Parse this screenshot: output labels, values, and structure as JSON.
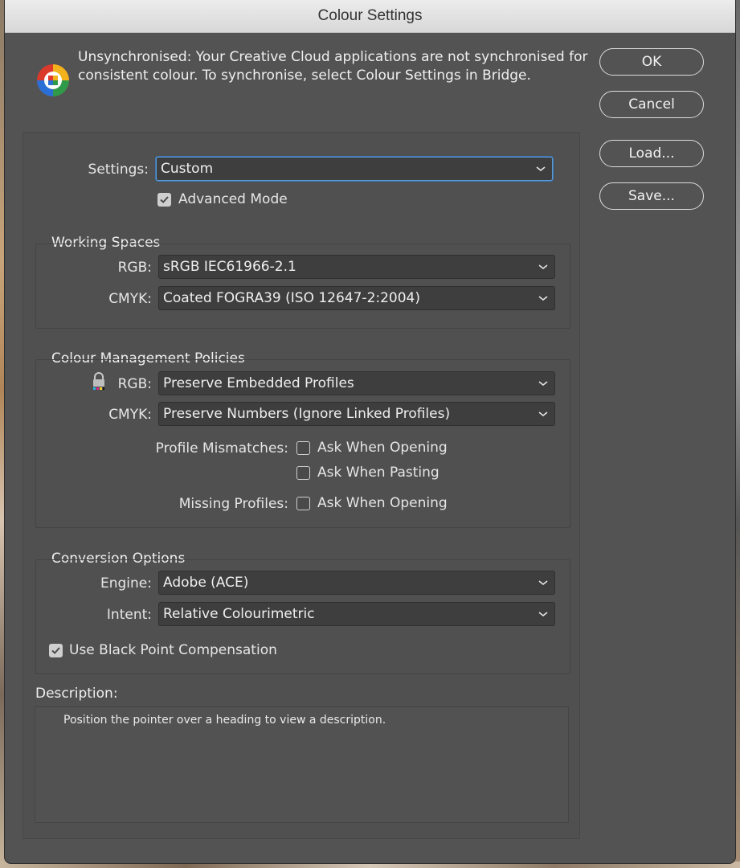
{
  "window": {
    "title": "Colour Settings"
  },
  "sync": {
    "icon": "colour-wheel-icon",
    "message": "Unsynchronised: Your Creative Cloud applications are not synchronised for consistent colour. To synchronise, select Colour Settings in Bridge."
  },
  "buttons": {
    "ok": "OK",
    "cancel": "Cancel",
    "load": "Load...",
    "save": "Save..."
  },
  "settings": {
    "label": "Settings:",
    "value": "Custom",
    "advanced_mode": {
      "label": "Advanced Mode",
      "checked": true
    }
  },
  "working_spaces": {
    "title": "Working Spaces",
    "rgb_label": "RGB:",
    "rgb_value": "sRGB IEC61966-2.1",
    "cmyk_label": "CMYK:",
    "cmyk_value": "Coated FOGRA39 (ISO 12647-2:2004)"
  },
  "policies": {
    "title": "Colour Management Policies",
    "lock_icon": "lock-icon",
    "rgb_label": "RGB:",
    "rgb_value": "Preserve Embedded Profiles",
    "cmyk_label": "CMYK:",
    "cmyk_value": "Preserve Numbers (Ignore Linked Profiles)",
    "profile_mismatches_label": "Profile Mismatches:",
    "mismatch_opening": {
      "label": "Ask When Opening",
      "checked": false
    },
    "mismatch_pasting": {
      "label": "Ask When Pasting",
      "checked": false
    },
    "missing_profiles_label": "Missing Profiles:",
    "missing_opening": {
      "label": "Ask When Opening",
      "checked": false
    }
  },
  "conversion": {
    "title": "Conversion Options",
    "engine_label": "Engine:",
    "engine_value": "Adobe (ACE)",
    "intent_label": "Intent:",
    "intent_value": "Relative Colourimetric",
    "black_point": {
      "label": "Use Black Point Compensation",
      "checked": true
    }
  },
  "description": {
    "title": "Description:",
    "text": "Position the pointer over a heading to view a description."
  },
  "colors": {
    "panel": "#535353",
    "field": "#3e3e3e",
    "focus": "#5d9bd6",
    "text": "#e6e6e6"
  }
}
